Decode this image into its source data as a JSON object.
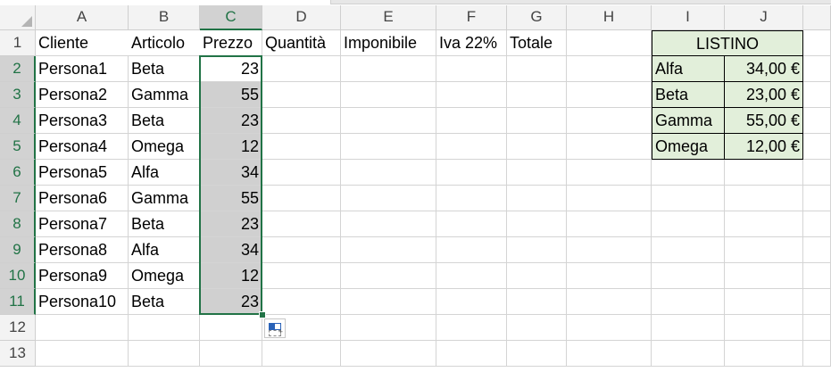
{
  "columns": [
    "A",
    "B",
    "C",
    "D",
    "E",
    "F",
    "G",
    "H",
    "I",
    "J"
  ],
  "rows": [
    "1",
    "2",
    "3",
    "4",
    "5",
    "6",
    "7",
    "8",
    "9",
    "10",
    "11",
    "12",
    "13"
  ],
  "selected_column": "C",
  "selected_rows": [
    "2",
    "3",
    "4",
    "5",
    "6",
    "7",
    "8",
    "9",
    "10",
    "11"
  ],
  "headers": {
    "cliente": "Cliente",
    "articolo": "Articolo",
    "prezzo": "Prezzo",
    "quantita": "Quantità",
    "imponibile": "Imponibile",
    "iva": "Iva 22%",
    "totale": "Totale"
  },
  "records": [
    {
      "cliente": "Persona1",
      "articolo": "Beta",
      "prezzo": "23"
    },
    {
      "cliente": "Persona2",
      "articolo": "Gamma",
      "prezzo": "55"
    },
    {
      "cliente": "Persona3",
      "articolo": "Beta",
      "prezzo": "23"
    },
    {
      "cliente": "Persona4",
      "articolo": "Omega",
      "prezzo": "12"
    },
    {
      "cliente": "Persona5",
      "articolo": "Alfa",
      "prezzo": "34"
    },
    {
      "cliente": "Persona6",
      "articolo": "Gamma",
      "prezzo": "55"
    },
    {
      "cliente": "Persona7",
      "articolo": "Beta",
      "prezzo": "23"
    },
    {
      "cliente": "Persona8",
      "articolo": "Alfa",
      "prezzo": "34"
    },
    {
      "cliente": "Persona9",
      "articolo": "Omega",
      "prezzo": "12"
    },
    {
      "cliente": "Persona10",
      "articolo": "Beta",
      "prezzo": "23"
    }
  ],
  "listino": {
    "title": "LISTINO",
    "items": [
      {
        "articolo": "Alfa",
        "prezzo": "34,00 €"
      },
      {
        "articolo": "Beta",
        "prezzo": "23,00 €"
      },
      {
        "articolo": "Gamma",
        "prezzo": "55,00 €"
      },
      {
        "articolo": "Omega",
        "prezzo": "12,00 €"
      }
    ]
  },
  "colors": {
    "selection_accent": "#217346",
    "selection_fill": "#d0d0d0",
    "listino_fill": "#e2efda"
  },
  "icons": {
    "quick_analysis": "quick-analysis-icon"
  }
}
